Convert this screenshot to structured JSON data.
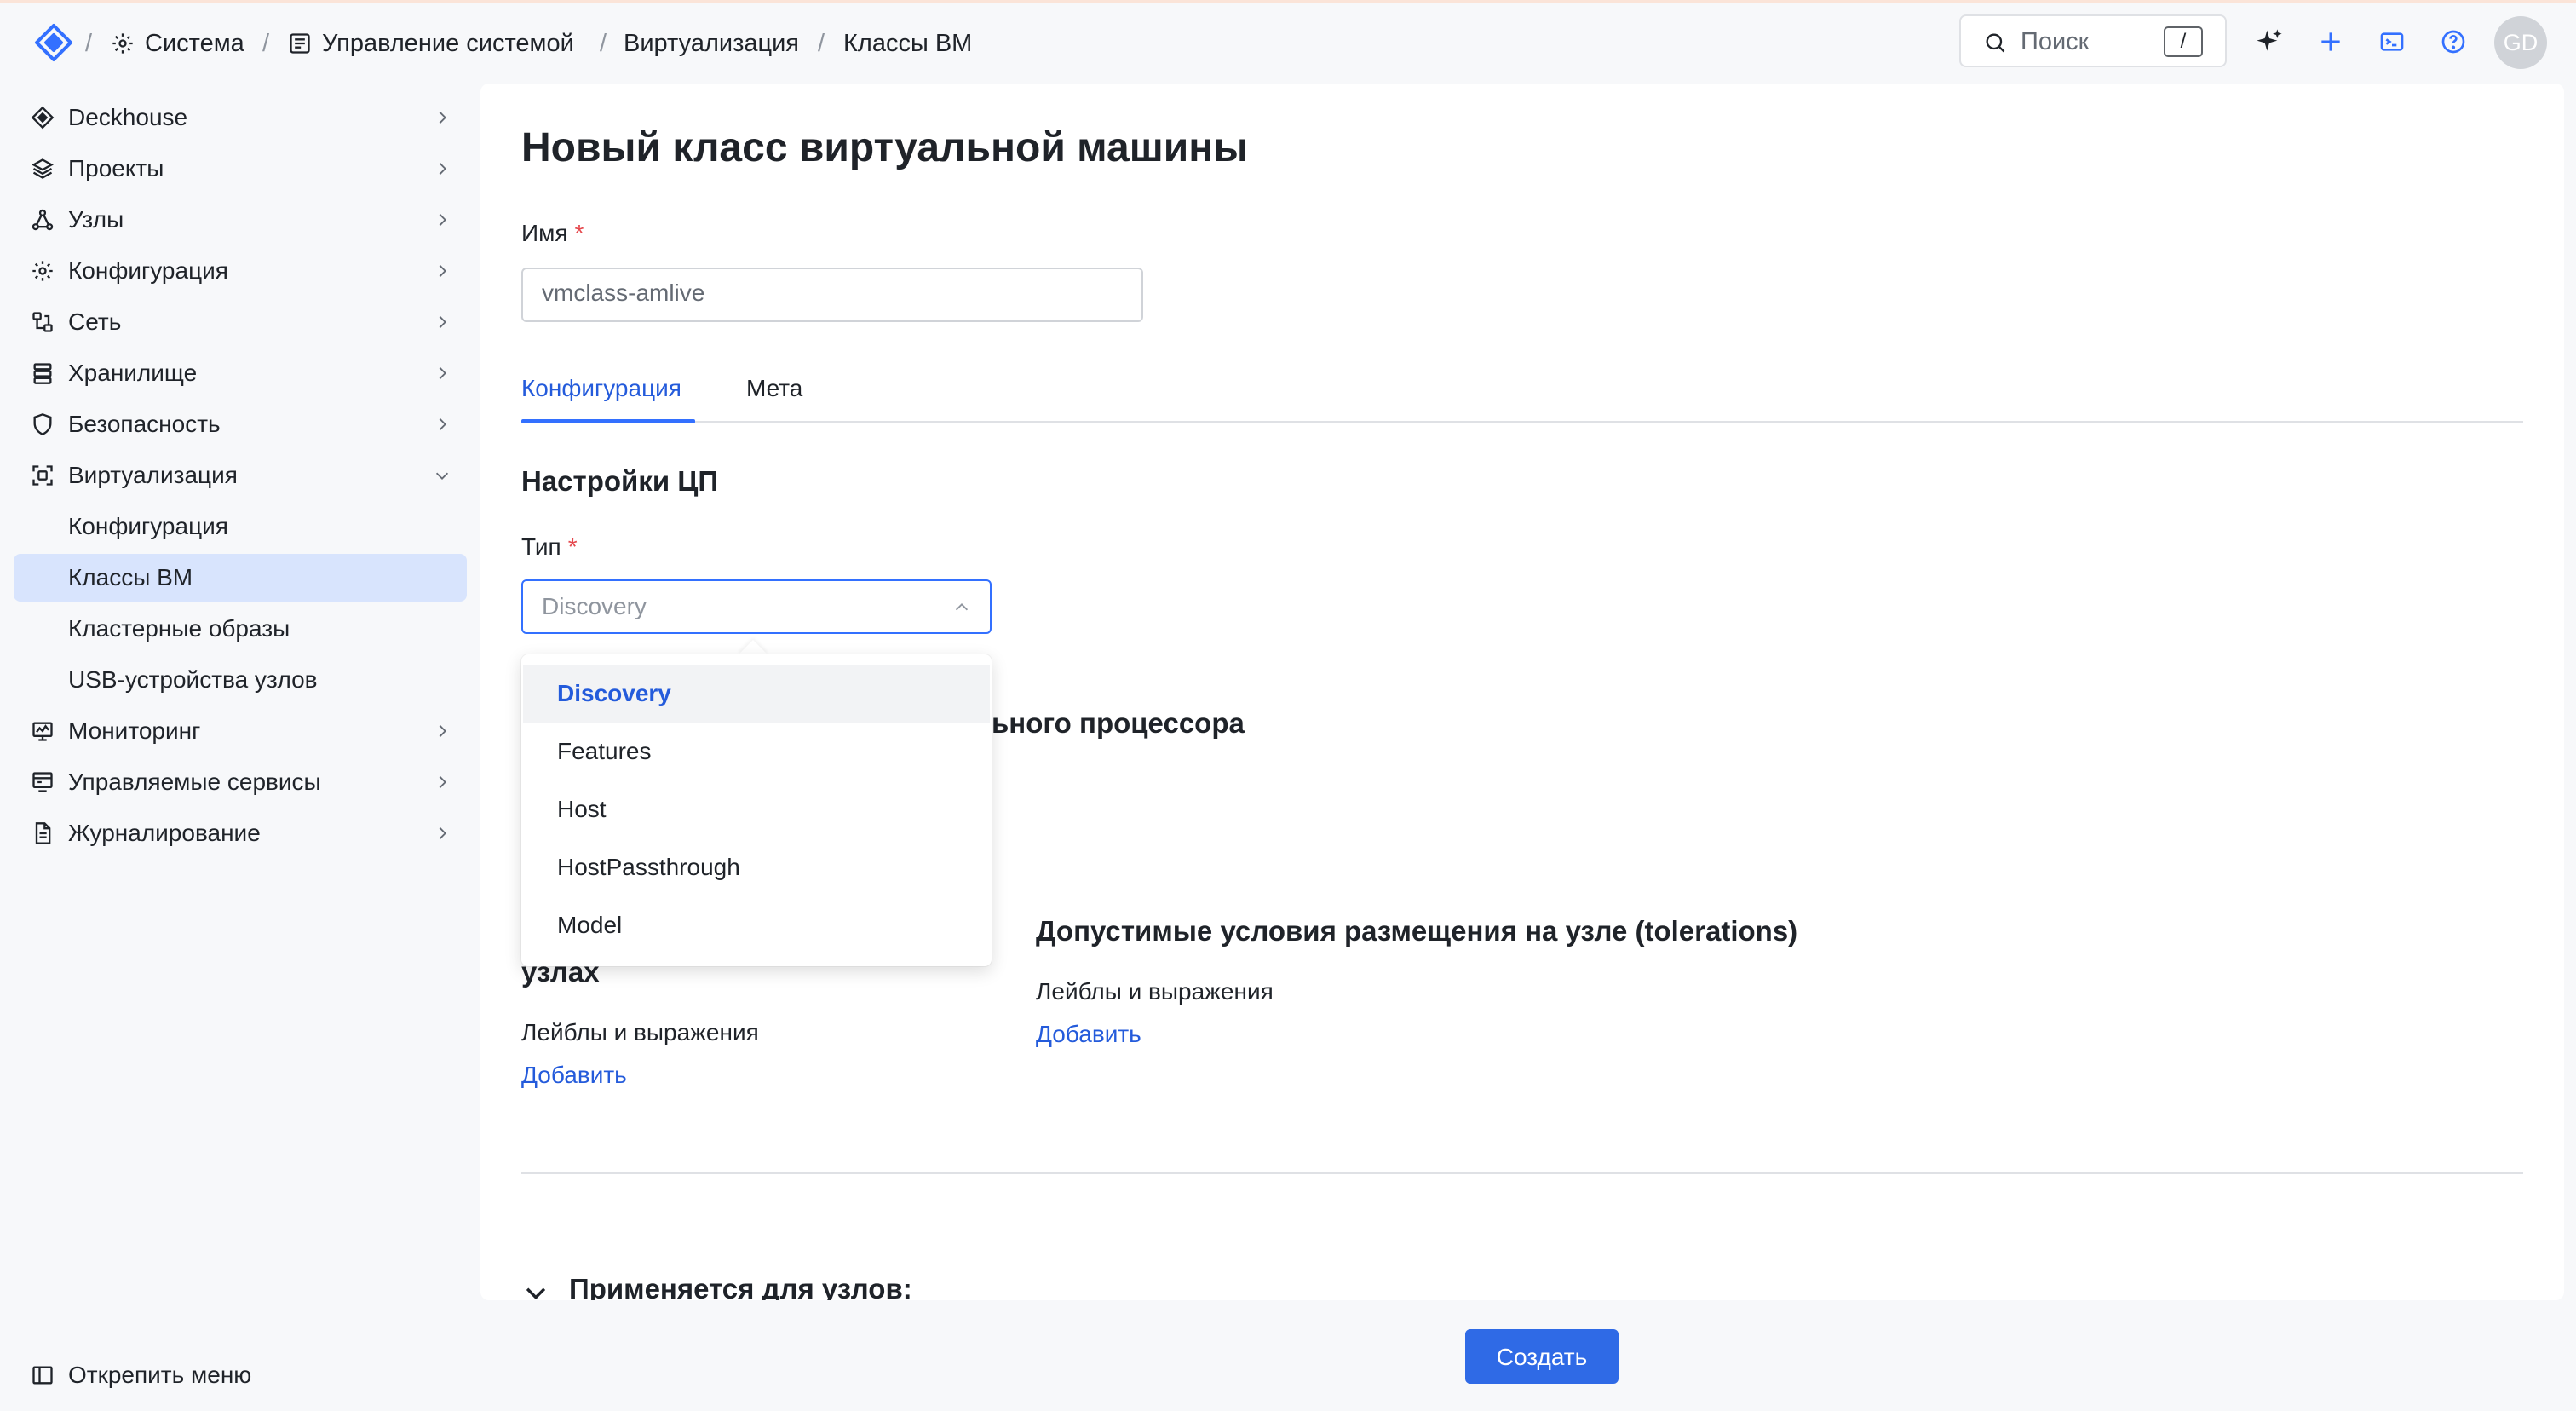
{
  "breadcrumb": {
    "items": [
      "Система",
      "Управление системой",
      "Виртуализация",
      "Классы ВМ"
    ],
    "separator": "/"
  },
  "header": {
    "search_placeholder": "Поиск",
    "search_shortcut": "/",
    "avatar_initials": "GD",
    "icons": [
      "sparkle-icon",
      "plus-icon",
      "terminal-icon",
      "help-icon"
    ]
  },
  "sidebar": {
    "items": [
      {
        "label": "Deckhouse",
        "icon": "deckhouse-icon"
      },
      {
        "label": "Проекты",
        "icon": "layers-icon"
      },
      {
        "label": "Узлы",
        "icon": "nodes-icon"
      },
      {
        "label": "Конфигурация",
        "icon": "gear-icon"
      },
      {
        "label": "Сеть",
        "icon": "network-icon"
      },
      {
        "label": "Хранилище",
        "icon": "storage-icon"
      },
      {
        "label": "Безопасность",
        "icon": "shield-icon"
      },
      {
        "label": "Виртуализация",
        "icon": "virtualization-icon"
      }
    ],
    "sub_items": [
      "Конфигурация",
      "Классы ВМ",
      "Кластерные образы",
      "USB-устройства узлов"
    ],
    "bottom_items": [
      {
        "label": "Мониторинг",
        "icon": "monitor-icon"
      },
      {
        "label": "Управляемые сервисы",
        "icon": "services-icon"
      },
      {
        "label": "Журналирование",
        "icon": "log-icon"
      }
    ],
    "unpin_label": "Открепить меню"
  },
  "form": {
    "title": "Новый класс виртуальной машины",
    "name_label": "Имя",
    "required_mark": "*",
    "name_value": "vmclass-amlive",
    "tabs": [
      "Конфигурация",
      "Мета"
    ],
    "cpu_section": "Настройки ЦП",
    "type_label": "Тип",
    "type_value": "Discovery",
    "hidden_section_tail": "ьного процессора",
    "placement_section_tail": "узлах",
    "tolerations_section": "Допустимые условия размещения на узле (tolerations)",
    "labels_expressions": "Лейблы и выражения",
    "add_link": "Добавить",
    "applies_section": "Применяется для узлов:",
    "create_button": "Создать"
  },
  "dropdown": {
    "options": [
      "Discovery",
      "Features",
      "Host",
      "HostPassthrough",
      "Model"
    ],
    "selected": "Discovery"
  },
  "colors": {
    "accent": "#3370ff",
    "link": "#245bdb",
    "primary_button": "#2f6ae6",
    "active_nav_bg": "#d8e4fd",
    "required": "#e5484d"
  }
}
